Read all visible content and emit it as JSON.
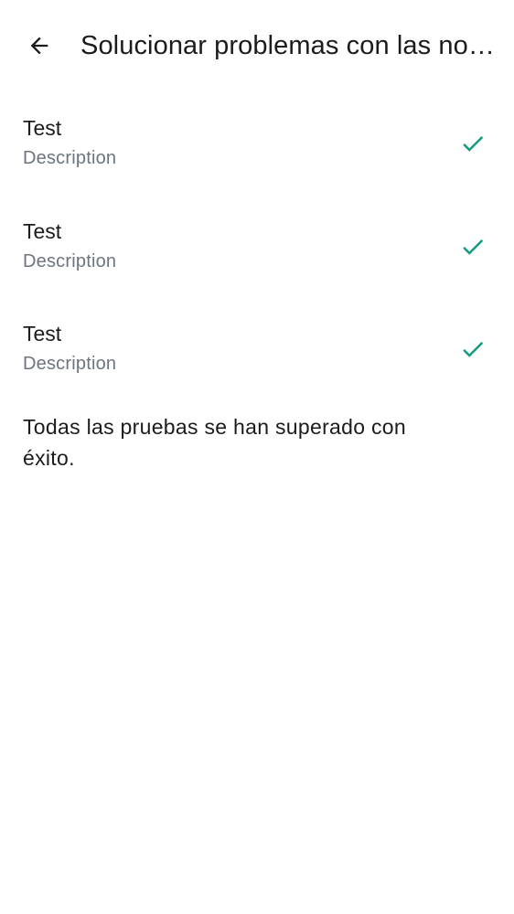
{
  "header": {
    "title": "Solucionar problemas con las notificaciones",
    "back_icon": "arrow-left-icon"
  },
  "tests": [
    {
      "title": "Test",
      "description": "Description",
      "status": "passed",
      "status_icon": "check-icon"
    },
    {
      "title": "Test",
      "description": "Description",
      "status": "passed",
      "status_icon": "check-icon"
    },
    {
      "title": "Test",
      "description": "Description",
      "status": "passed",
      "status_icon": "check-icon"
    }
  ],
  "result": {
    "message": "Todas las pruebas se han superado con éxito."
  },
  "colors": {
    "success": "#129b7e",
    "text_primary": "#1b1c1e",
    "text_secondary": "#6b7480"
  }
}
